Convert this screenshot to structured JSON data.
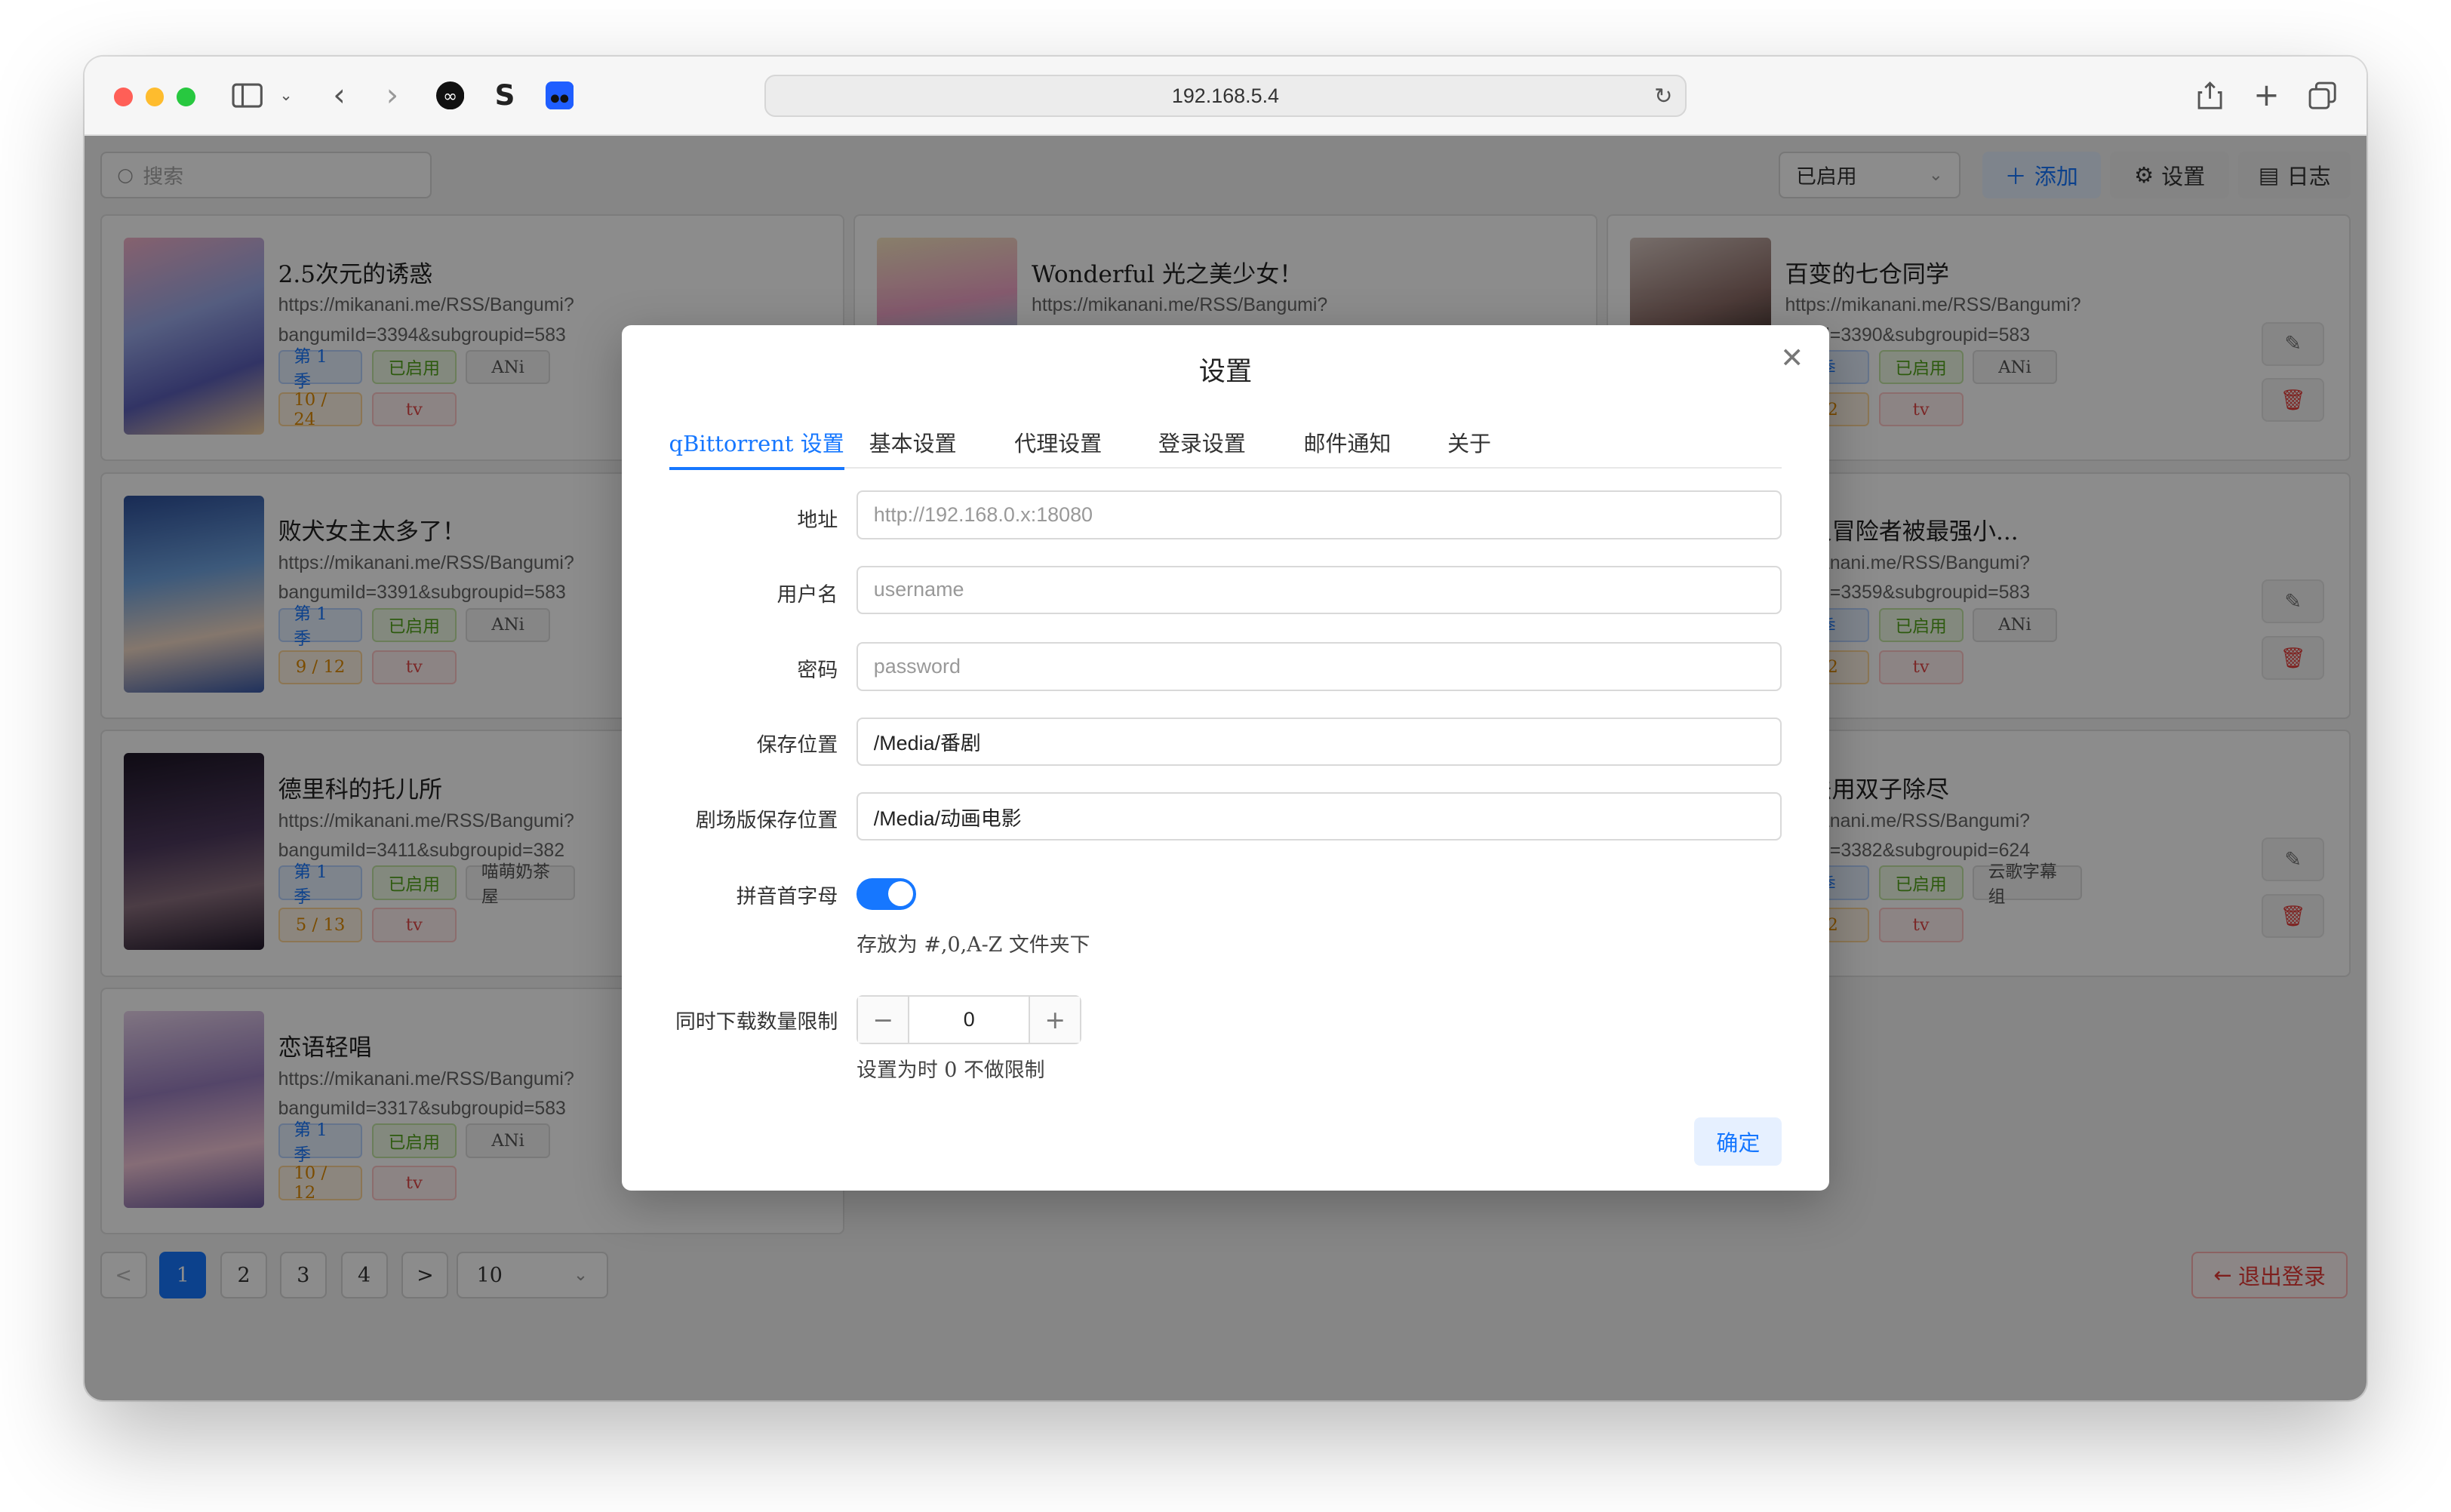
{
  "browser": {
    "url": "192.168.5.4"
  },
  "header": {
    "search_placeholder": "搜索",
    "status_filter": "已启用",
    "add_label": "添加",
    "settings_label": "设置",
    "log_label": "日志"
  },
  "cards": [
    {
      "title": "2.5次元的诱惑",
      "url_line1": "https://mikanani.me/RSS/Bangumi?",
      "url_line2": "bangumiId=3394&subgroupid=583",
      "season": "第 1 季",
      "status": "已启用",
      "group": "ANi",
      "progress": "10 / 24",
      "type": "tv"
    },
    {
      "title": "Wonderful 光之美少女！",
      "url_line1": "https://mikanani.me/RSS/Bangumi?",
      "url_line2": "",
      "season": "",
      "status": "",
      "group": "",
      "progress": "",
      "type": ""
    },
    {
      "title": "百变的七仓同学",
      "url_line1": "https://mikanani.me/RSS/Bangumi?",
      "url_line2": "umild=3390&subgroupid=583",
      "season": "季",
      "status": "已启用",
      "group": "ANi",
      "progress": "12",
      "type": "tv"
    },
    {
      "title": "败犬女主太多了！",
      "url_line1": "https://mikanani.me/RSS/Bangumi?",
      "url_line2": "bangumiId=3391&subgroupid=583",
      "season": "第 1 季",
      "status": "已启用",
      "group": "ANi",
      "progress": "9 / 12",
      "type": "tv"
    },
    {
      "title": "新人冒险者被最强小...",
      "url_line1": "/mikanani.me/RSS/Bangumi?",
      "url_line2": "umild=3359&subgroupid=583",
      "season": "季",
      "status": "已启用",
      "group": "ANi",
      "progress": "12",
      "type": "tv"
    },
    {
      "title": "德里科的托儿所",
      "url_line1": "https://mikanani.me/RSS/Bangumi?",
      "url_line2": "bangumiId=3411&subgroupid=382",
      "season": "第 1 季",
      "status": "已启用",
      "group": "喵萌奶茶屋",
      "progress": "5 / 13",
      "type": "tv"
    },
    {
      "title": "没法用双子除尽",
      "url_line1": "/mikanani.me/RSS/Bangumi?",
      "url_line2": "umild=3382&subgroupid=624",
      "season": "季",
      "status": "已启用",
      "group": "云歌字幕组",
      "progress": "12",
      "type": "tv"
    },
    {
      "title": "恋语轻唱",
      "url_line1": "https://mikanani.me/RSS/Bangumi?",
      "url_line2": "bangumiId=3317&subgroupid=583",
      "season": "第 1 季",
      "status": "已启用",
      "group": "ANi",
      "progress": "10 / 12",
      "type": "tv"
    }
  ],
  "pagination": {
    "pages": [
      "1",
      "2",
      "3",
      "4"
    ],
    "prev": "<",
    "next": ">",
    "page_size": "10"
  },
  "logout_label": "退出登录",
  "modal": {
    "title": "设置",
    "tabs": [
      "qBittorrent 设置",
      "基本设置",
      "代理设置",
      "登录设置",
      "邮件通知",
      "关于"
    ],
    "fields": {
      "address_label": "地址",
      "address_placeholder": "http://192.168.0.x:18080",
      "username_label": "用户名",
      "username_placeholder": "username",
      "password_label": "密码",
      "password_placeholder": "password",
      "save_path_label": "保存位置",
      "save_path_value": "/Media/番剧",
      "movie_path_label": "剧场版保存位置",
      "movie_path_value": "/Media/动画电影",
      "pinyin_label": "拼音首字母",
      "pinyin_enabled": true,
      "pinyin_hint": "存放为 #,0,A-Z 文件夹下",
      "limit_label": "同时下载数量限制",
      "limit_value": "0",
      "limit_hint": "设置为时 0 不做限制"
    },
    "ok_label": "确定"
  },
  "colors": {
    "accent": "#1677ff",
    "green_tag": "#52a41a",
    "danger": "#e53935"
  }
}
